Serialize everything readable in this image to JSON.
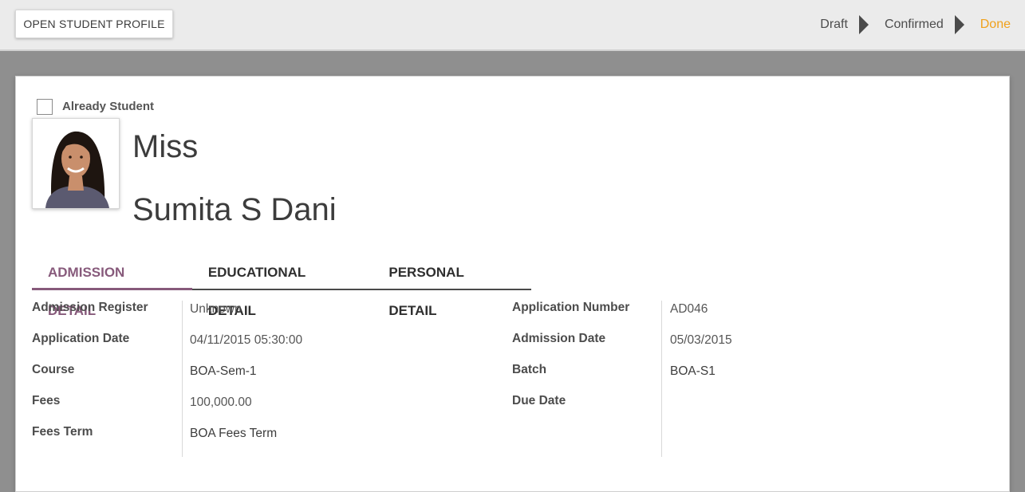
{
  "statusbar": {
    "open_profile_label": "OPEN STUDENT PROFILE",
    "stages": [
      "Draft",
      "Confirmed",
      "Done"
    ],
    "active_stage_color": "#f0a11c"
  },
  "form": {
    "already_student_label": "Already Student",
    "already_student_checked": false,
    "title": "Miss",
    "name": "Sumita S Dani"
  },
  "tabs": [
    "ADMISSION DETAIL",
    "EDUCATIONAL DETAIL",
    "PERSONAL DETAIL"
  ],
  "accent_color": "#875a7b",
  "left_fields": [
    {
      "label": "Admission Register",
      "value": "Unknown"
    },
    {
      "label": "Application Date",
      "value": "04/11/2015 05:30:00"
    },
    {
      "label": "Course",
      "value": "BOA-Sem-1"
    },
    {
      "label": "Fees",
      "value": "100,000.00"
    },
    {
      "label": "Fees Term",
      "value": "BOA Fees Term"
    }
  ],
  "right_fields": [
    {
      "label": "Application Number",
      "value": "AD046"
    },
    {
      "label": "Admission Date",
      "value": "05/03/2015"
    },
    {
      "label": "Batch",
      "value": "BOA-S1"
    },
    {
      "label": "Due Date",
      "value": ""
    }
  ]
}
